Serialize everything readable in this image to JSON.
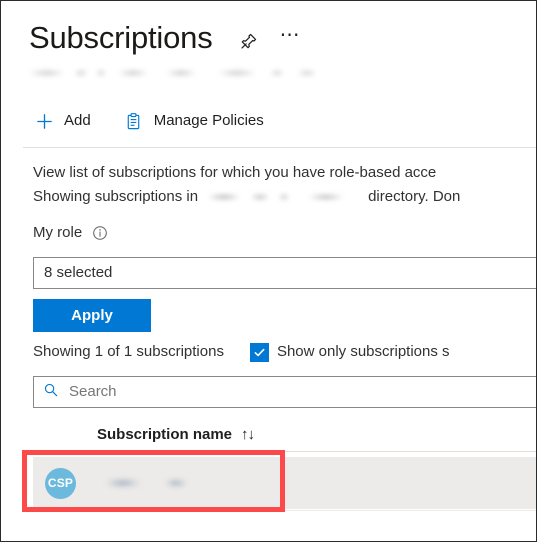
{
  "header": {
    "title": "Subscriptions",
    "pin_icon": "pin-icon",
    "more_icon": "ellipsis-icon",
    "subtitle_redacted": true
  },
  "command_bar": {
    "items": [
      {
        "label": "Add",
        "icon": "plus-icon"
      },
      {
        "label": "Manage Policies",
        "icon": "clipboard-icon"
      }
    ]
  },
  "description": {
    "line1": "View list of subscriptions for which you have role-based acce",
    "line2_prefix": "Showing subscriptions in",
    "line2_suffix": "directory. Don"
  },
  "filters": {
    "my_role_label": "My role",
    "info_icon": "info-icon",
    "role_select_value": "8 selected",
    "apply_label": "Apply"
  },
  "status": {
    "showing_text": "Showing 1 of 1 subscriptions",
    "checkbox_label": "Show only subscriptions s",
    "checkbox_checked": true
  },
  "search": {
    "placeholder": "Search",
    "value": "",
    "icon": "search-icon"
  },
  "table": {
    "column_header": "Subscription name",
    "sort_icon": "↑↓",
    "rows": [
      {
        "badge": "CSP",
        "name_redacted": true
      }
    ]
  },
  "colors": {
    "accent": "#0078d4",
    "badge": "#6cb9de",
    "row_background": "#edebe9",
    "annotation": "#fc4a4a"
  }
}
